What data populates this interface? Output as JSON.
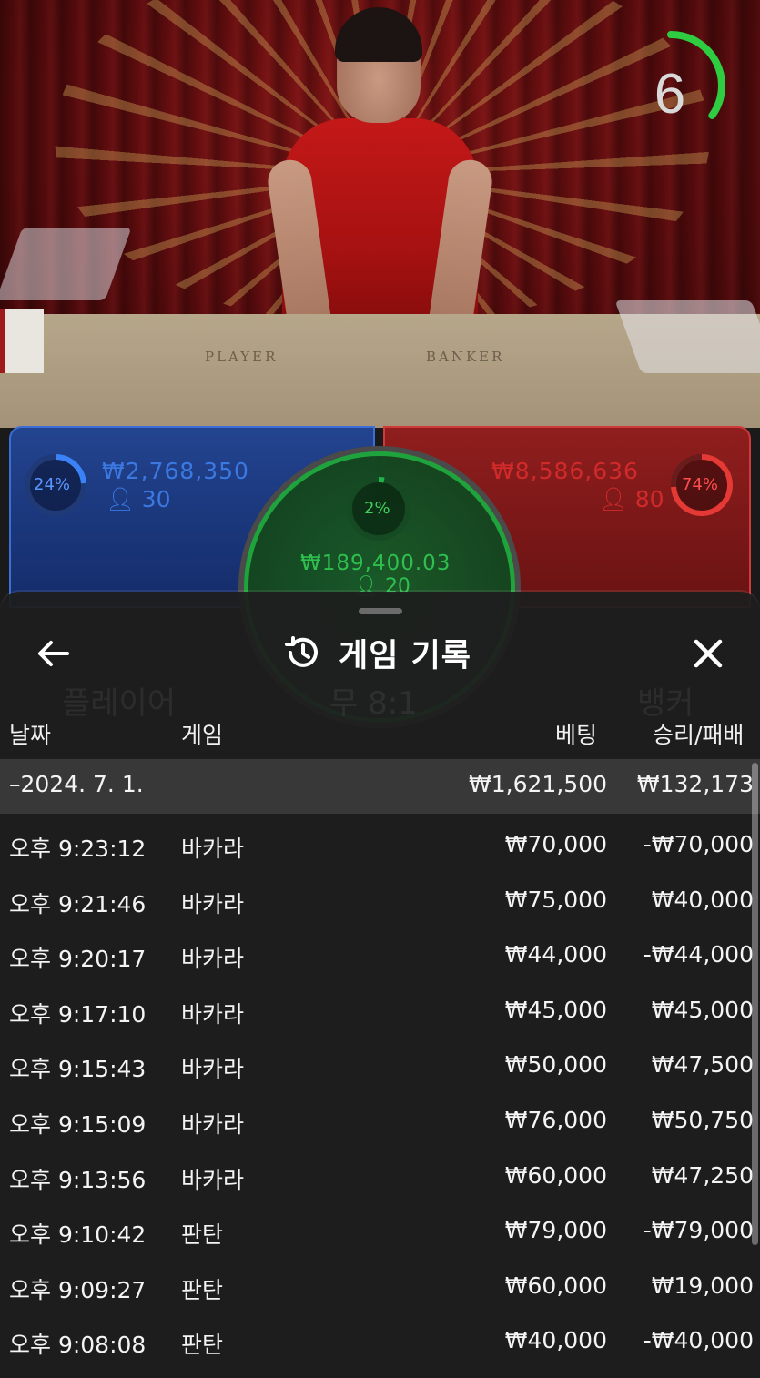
{
  "video": {
    "table_labels": {
      "player": "PLAYER",
      "banker": "BANKER"
    },
    "timer": {
      "value": "6",
      "progress": 0.35,
      "color": "#2ecc40"
    }
  },
  "bets": {
    "player": {
      "percent": "24%",
      "amount": "₩2,768,350",
      "count": "30",
      "color": "#3b82f6"
    },
    "banker": {
      "percent": "74%",
      "amount": "₩8,586,636",
      "count": "80",
      "color": "#e53935"
    },
    "tie": {
      "percent": "2%",
      "amount": "₩189,400.03",
      "count": "20",
      "color": "#22b14c"
    }
  },
  "sheet": {
    "title": "게임 기록",
    "icons": {
      "back": "arrow-left-icon",
      "history": "history-icon",
      "close": "close-icon"
    },
    "background_labels": [
      "플레이어",
      "무 8:1",
      "뱅커"
    ],
    "columns": {
      "date": "날짜",
      "game": "게임",
      "bet": "베팅",
      "result": "승리/패배"
    },
    "summary": {
      "date": "–2024. 7. 1.",
      "bet": "₩1,621,500",
      "result": "₩132,173"
    },
    "rows": [
      {
        "time": "오후 9:23:12",
        "game": "바카라",
        "bet": "₩70,000",
        "result": "-₩70,000"
      },
      {
        "time": "오후 9:21:46",
        "game": "바카라",
        "bet": "₩75,000",
        "result": "₩40,000"
      },
      {
        "time": "오후 9:20:17",
        "game": "바카라",
        "bet": "₩44,000",
        "result": "-₩44,000"
      },
      {
        "time": "오후 9:17:10",
        "game": "바카라",
        "bet": "₩45,000",
        "result": "₩45,000"
      },
      {
        "time": "오후 9:15:43",
        "game": "바카라",
        "bet": "₩50,000",
        "result": "₩47,500"
      },
      {
        "time": "오후 9:15:09",
        "game": "바카라",
        "bet": "₩76,000",
        "result": "₩50,750"
      },
      {
        "time": "오후 9:13:56",
        "game": "바카라",
        "bet": "₩60,000",
        "result": "₩47,250"
      },
      {
        "time": "오후 9:10:42",
        "game": "판탄",
        "bet": "₩79,000",
        "result": "-₩79,000"
      },
      {
        "time": "오후 9:09:27",
        "game": "판탄",
        "bet": "₩60,000",
        "result": "₩19,000"
      },
      {
        "time": "오후 9:08:08",
        "game": "판탄",
        "bet": "₩40,000",
        "result": "-₩40,000"
      }
    ]
  }
}
